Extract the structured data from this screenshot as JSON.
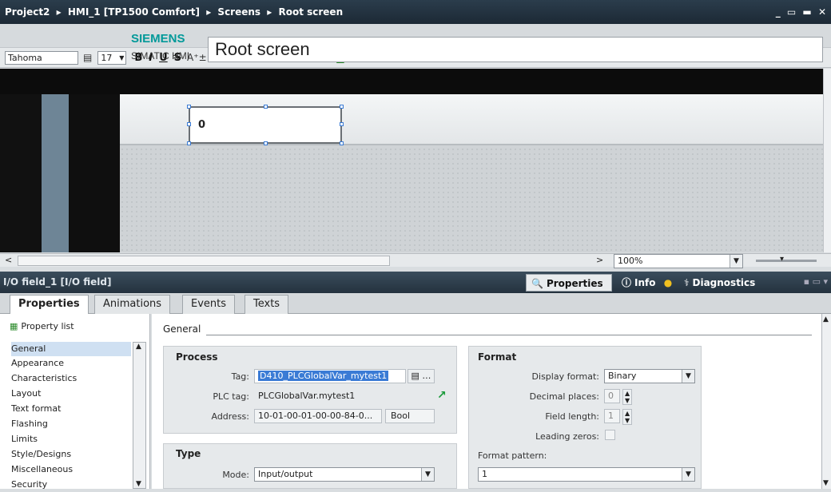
{
  "titlebar": {
    "breadcrumb": [
      "Project2",
      "HMI_1 [TP1500 Comfort]",
      "Screens",
      "Root screen"
    ],
    "separator": "▸",
    "window_controls": "_ ▭ ▬ ✕"
  },
  "format_toolbar": {
    "font_name": "Tahoma",
    "font_size": "17",
    "bold": "B",
    "italic": "I",
    "underline": "U",
    "strike": "S"
  },
  "screen": {
    "brand": "SIEMENS",
    "product": "SIMATIC HMI",
    "title": "Root screen",
    "io_field_value": "0"
  },
  "view": {
    "zoom": "100%"
  },
  "inspector": {
    "title": "I/O field_1 [I/O field]",
    "tabs": {
      "properties": "Properties",
      "info": "Info",
      "diagnostics": "Diagnostics"
    },
    "subtabs": [
      "Properties",
      "Animations",
      "Events",
      "Texts"
    ],
    "property_list_label": "Property list",
    "nav_items": [
      "General",
      "Appearance",
      "Characteristics",
      "Layout",
      "Text format",
      "Flashing",
      "Limits",
      "Style/Designs",
      "Miscellaneous",
      "Security"
    ],
    "section_title": "General",
    "process": {
      "title": "Process",
      "tag_label": "Tag:",
      "tag_value": "D410_PLCGlobalVar_mytest1",
      "plc_tag_label": "PLC tag:",
      "plc_tag_value": "PLCGlobalVar.mytest1",
      "address_label": "Address:",
      "address_value": "10-01-00-01-00-00-84-0...",
      "address_type": "Bool"
    },
    "type": {
      "title": "Type",
      "mode_label": "Mode:",
      "mode_value": "Input/output"
    },
    "format": {
      "title": "Format",
      "display_format_label": "Display format:",
      "display_format_value": "Binary",
      "decimal_places_label": "Decimal places:",
      "decimal_places_value": "0",
      "field_length_label": "Field length:",
      "field_length_value": "1",
      "leading_zeros_label": "Leading zeros:",
      "format_pattern_label": "Format pattern:",
      "format_pattern_value": "1"
    }
  },
  "colors": {
    "titlebar": "#1c2935",
    "siemens_teal": "#009999",
    "selection": "#3a7bd5"
  }
}
